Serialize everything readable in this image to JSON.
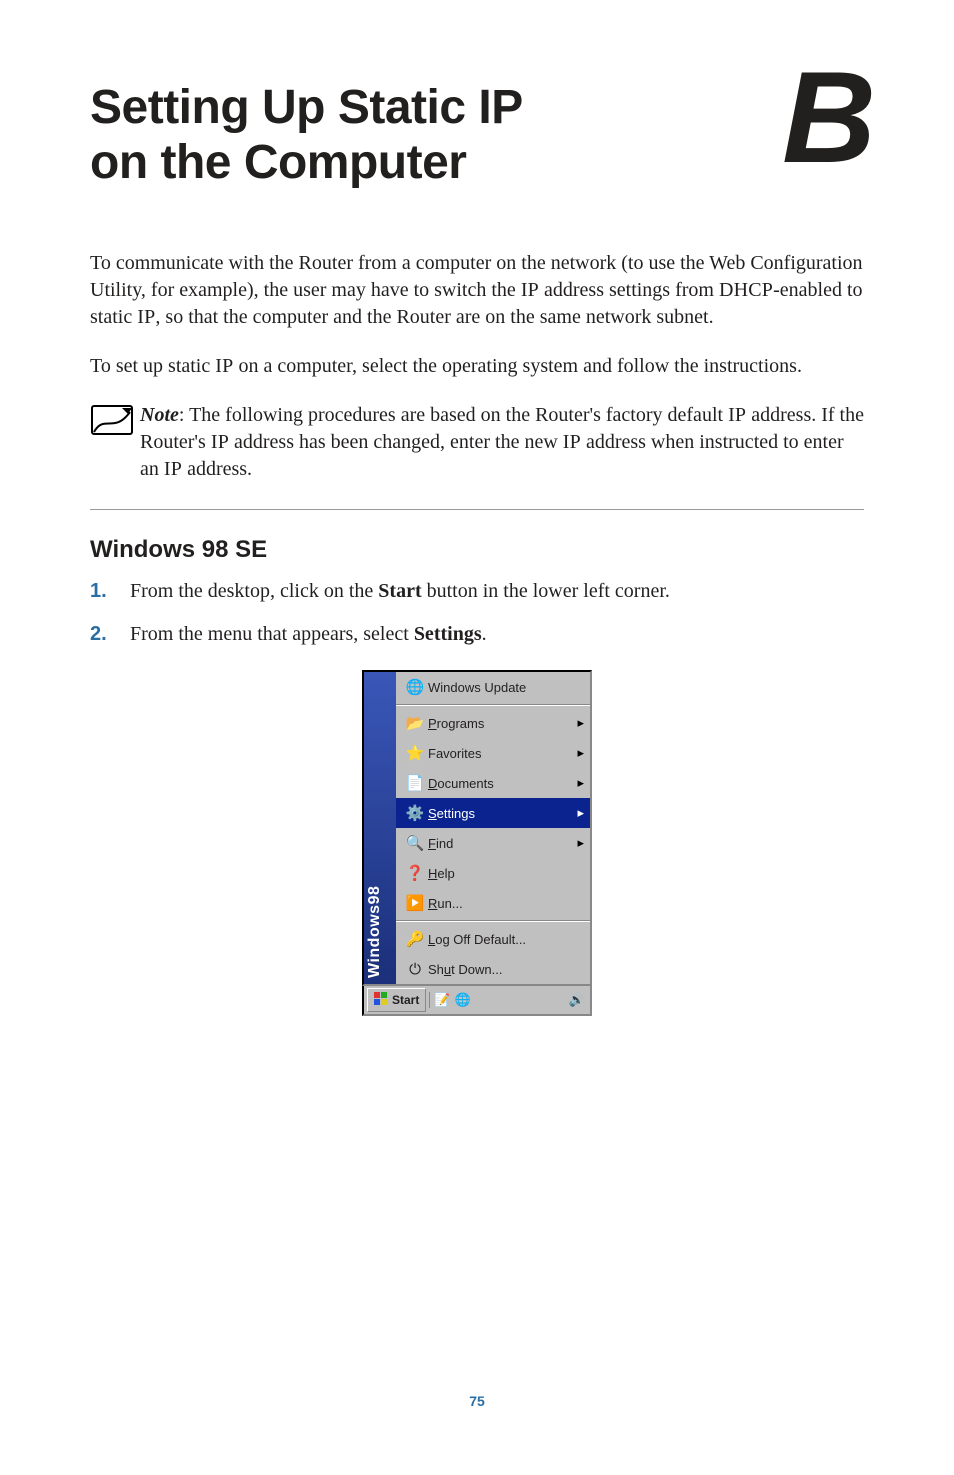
{
  "header": {
    "title_line1": "Setting Up Static IP",
    "title_line2": "on the Computer",
    "big_letter": "B"
  },
  "para1": {
    "pre": "To communicate with the Router from a computer on the network (to use the Web Configuration Utility, for example), the user may have to switch the ",
    "sc1": "IP",
    "mid1": " address settings from ",
    "sc2": "DHCP",
    "mid2": "-enabled to static ",
    "sc3": "IP",
    "post": ", so that the computer and the Router are on the same network subnet."
  },
  "para2": {
    "pre": "To set up static ",
    "sc1": "IP",
    "post": " on a computer, select the operating system and follow the instructions."
  },
  "note": {
    "label": "Note",
    "t1": ": The following procedures are based on the Router's factory default ",
    "sc1": "IP",
    "t2": " address. If the Router's ",
    "sc2": "IP",
    "t3": " address has been changed, enter the new ",
    "sc3": "IP",
    "t4": " address when instructed to enter an ",
    "sc4": "IP",
    "t5": " address."
  },
  "section": {
    "heading": "Windows 98 SE"
  },
  "steps": {
    "n1": "1.",
    "s1_pre": "From the desktop, click on the ",
    "s1_bold": "Start",
    "s1_post": " button in the lower left corner.",
    "n2": "2.",
    "s2_pre": "From the menu that appears, select ",
    "s2_bold": "Settings",
    "s2_post": "."
  },
  "startmenu": {
    "stripe": "Windows98",
    "items": [
      {
        "icon": "🌐",
        "u": "",
        "rest": "Windows Update",
        "arrow": ""
      },
      {
        "icon": "📂",
        "u": "P",
        "rest": "rograms",
        "arrow": "▸"
      },
      {
        "icon": "⭐",
        "u": "",
        "rest": "Favorites",
        "arrow": "▸"
      },
      {
        "icon": "📄",
        "u": "D",
        "rest": "ocuments",
        "arrow": "▸"
      },
      {
        "icon": "⚙️",
        "u": "S",
        "rest": "ettings",
        "arrow": "▸",
        "selected": true
      },
      {
        "icon": "🔍",
        "u": "F",
        "rest": "ind",
        "arrow": "▸"
      },
      {
        "icon": "❓",
        "u": "H",
        "rest": "elp",
        "arrow": ""
      },
      {
        "icon": "▶️",
        "u": "R",
        "rest": "un...",
        "arrow": ""
      },
      {
        "icon": "🔑",
        "u": "L",
        "rest": "og Off Default...",
        "arrow": ""
      },
      {
        "icon": "⏻",
        "u": "",
        "rest": "Shut Down...",
        "arrow": "",
        "pre": "Sh",
        "uMid": "u",
        "postMid": "t Down..."
      }
    ],
    "taskbar": {
      "start_label": "Start",
      "ql1": "📝",
      "ql2": "🌐",
      "tray": "🔊"
    }
  },
  "page_number": "75"
}
